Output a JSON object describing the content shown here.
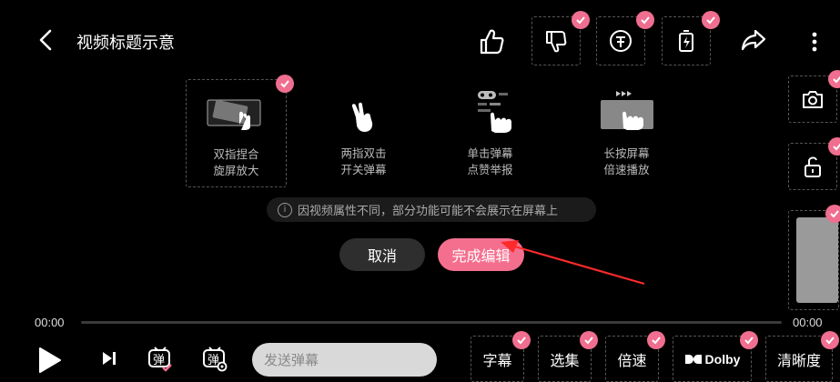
{
  "header": {
    "title": "视频标题示意",
    "icons": [
      "back-icon",
      "like-icon",
      "dislike-icon",
      "coin-icon",
      "battery-charge-icon",
      "share-icon",
      "more-icon"
    ]
  },
  "gestures": [
    {
      "label_1": "双指捏合",
      "label_2": "旋屏放大"
    },
    {
      "label_1": "两指双击",
      "label_2": "开关弹幕"
    },
    {
      "label_1": "单击弹幕",
      "label_2": "点赞举报"
    },
    {
      "label_1": "长按屏幕",
      "label_2": "倍速播放"
    }
  ],
  "hint": "因视频属性不同，部分功能可能不会展示在屏幕上",
  "info_glyph": "i",
  "dialog": {
    "cancel": "取消",
    "done": "完成编辑"
  },
  "player": {
    "current_time": "00:00",
    "total_time": "00:00",
    "progress": 0
  },
  "danmaku": {
    "placeholder": "发送弹幕"
  },
  "bottom_buttons": {
    "subtitle": "字幕",
    "episodes": "选集",
    "speed": "倍速",
    "dolby": "Dolby",
    "quality": "清晰度"
  },
  "colors": {
    "accent": "#f46f8e",
    "background": "#000000",
    "arrow": "#ff2a2a"
  }
}
